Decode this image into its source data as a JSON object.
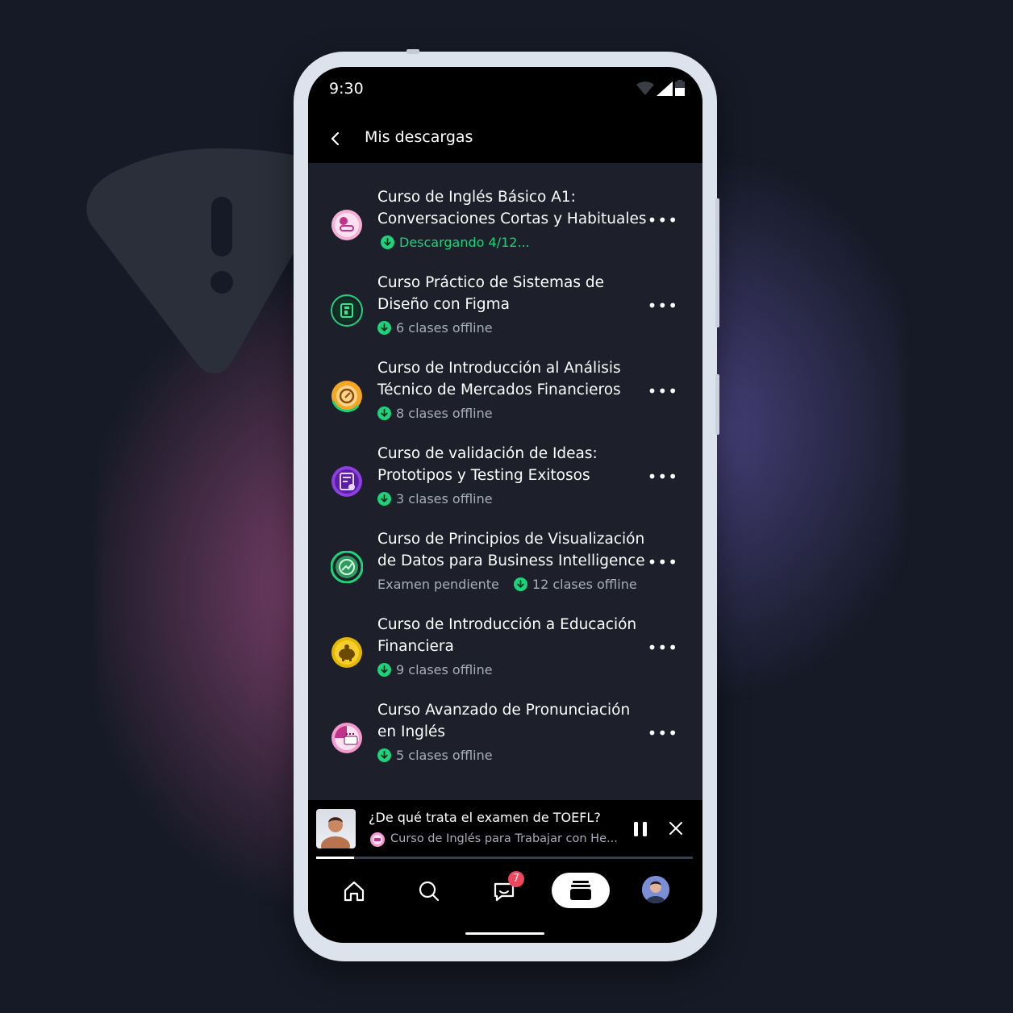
{
  "status_bar": {
    "time": "9:30"
  },
  "app_bar": {
    "title": "Mis descargas",
    "back_icon": "chevron-left-icon"
  },
  "colors": {
    "accent_green": "#1ed27a",
    "badge_red": "#f0475e",
    "background": "#1d202a"
  },
  "courses": [
    {
      "title": "Curso de Inglés Básico A1: Conversaciones Cortas y Habituales",
      "meta_prefix": "",
      "status": "Descargando 4/12...",
      "state": "downloading",
      "icon": "english-course-icon"
    },
    {
      "title": "Curso Práctico de Sistemas de Diseño con Figma",
      "meta_prefix": "",
      "status": "6 clases offline",
      "state": "offline",
      "icon": "figma-course-icon"
    },
    {
      "title": "Curso de Introducción al Análisis Técnico de Mercados Financieros",
      "meta_prefix": "",
      "status": "8 clases offline",
      "state": "offline",
      "icon": "finance-chart-icon"
    },
    {
      "title": "Curso de validación de Ideas: Prototipos y Testing Exitosos",
      "meta_prefix": "",
      "status": "3 clases offline",
      "state": "offline",
      "icon": "prototype-icon"
    },
    {
      "title": "Curso de Principios de Visualización de Datos para Business Intelligence",
      "meta_prefix": "Examen pendiente",
      "status": "12 clases offline",
      "state": "offline",
      "icon": "data-viz-icon"
    },
    {
      "title": "Curso de Introducción a Educación Financiera",
      "meta_prefix": "",
      "status": "9 clases offline",
      "state": "offline",
      "icon": "piggy-bank-icon"
    },
    {
      "title": "Curso Avanzado de Pronunciación en Inglés",
      "meta_prefix": "",
      "status": "5 clases offline",
      "state": "offline",
      "icon": "english-pronunciation-icon"
    }
  ],
  "mini_player": {
    "title": "¿De qué trata el examen de TOEFL?",
    "subtitle": "Curso de Inglés para Trabajar con He...",
    "progress": 0.1
  },
  "bottom_nav": {
    "items": [
      "home-icon",
      "search-icon",
      "messages-icon",
      "downloads-icon",
      "profile-avatar"
    ],
    "messages_badge": "7",
    "active": "downloads"
  }
}
